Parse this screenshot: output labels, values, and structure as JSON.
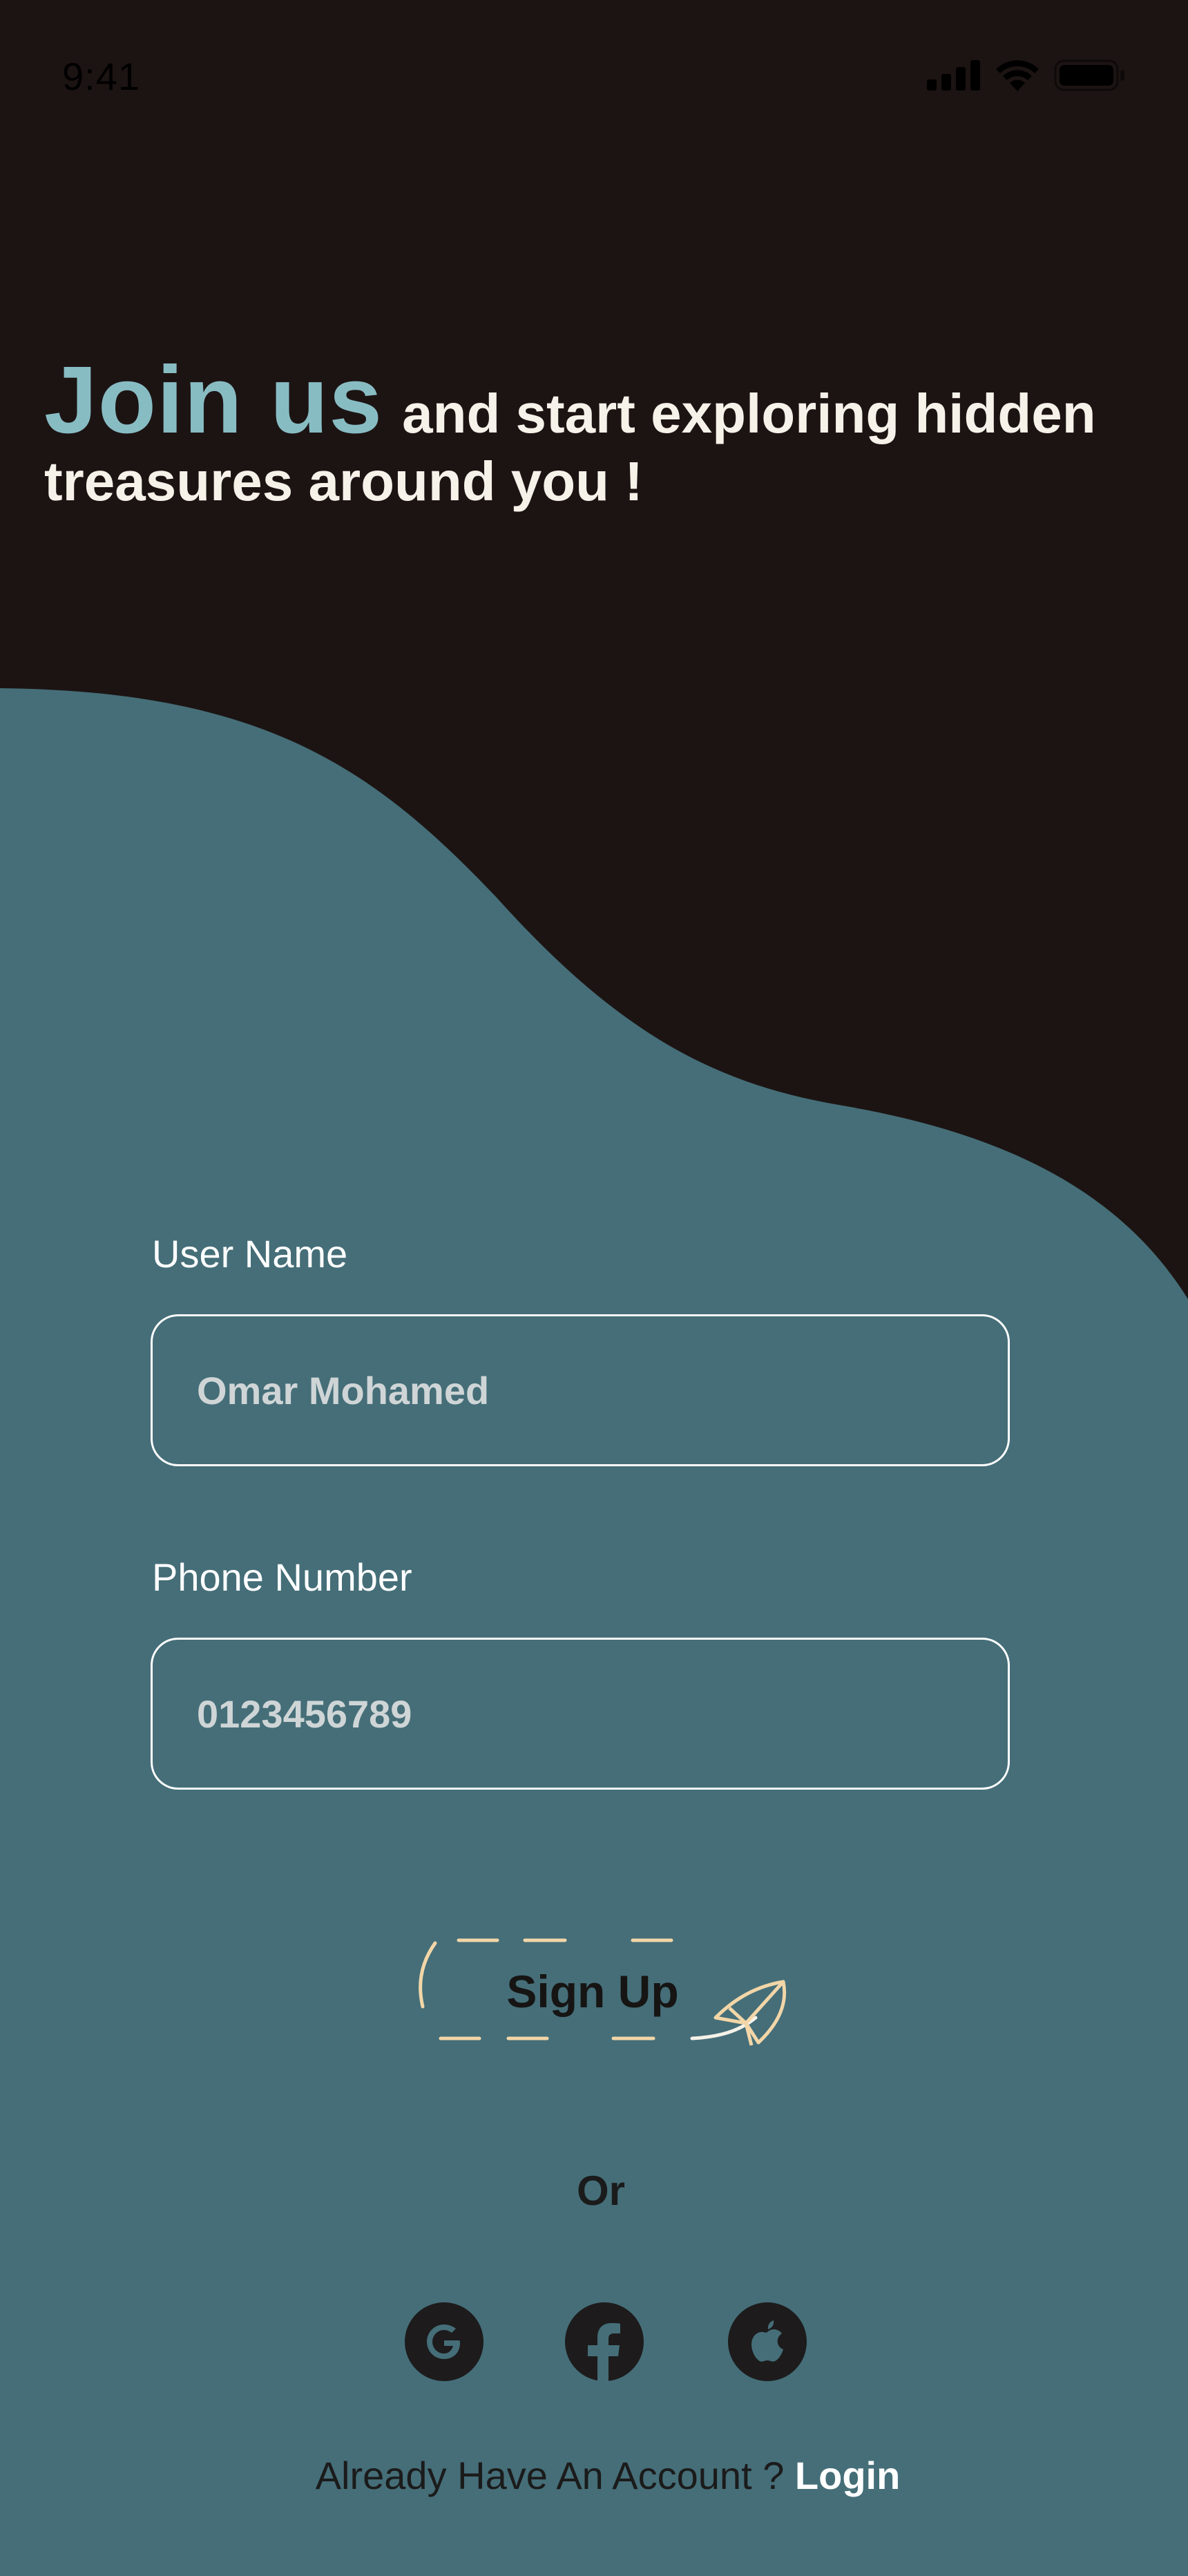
{
  "status_bar": {
    "time": "9:41"
  },
  "headline": {
    "accent": "Join us",
    "rest": "and start exploring hidden treasures around you !"
  },
  "form": {
    "username": {
      "label": "User Name",
      "value": "Omar Mohamed"
    },
    "phone": {
      "label": "Phone Number",
      "value": "0123456789"
    },
    "submit_label": "Sign Up"
  },
  "divider_text": "Or",
  "social": [
    {
      "name": "google-icon"
    },
    {
      "name": "facebook-icon"
    },
    {
      "name": "apple-icon"
    }
  ],
  "footer": {
    "prompt": "Already Have An Account ?",
    "login_label": "Login"
  },
  "colors": {
    "background_dark": "#1c1413",
    "wave_teal": "#456e78",
    "accent_teal": "#88bcc3",
    "headline_text": "#f6f2e9",
    "button_dash": "#f2d6a8"
  }
}
